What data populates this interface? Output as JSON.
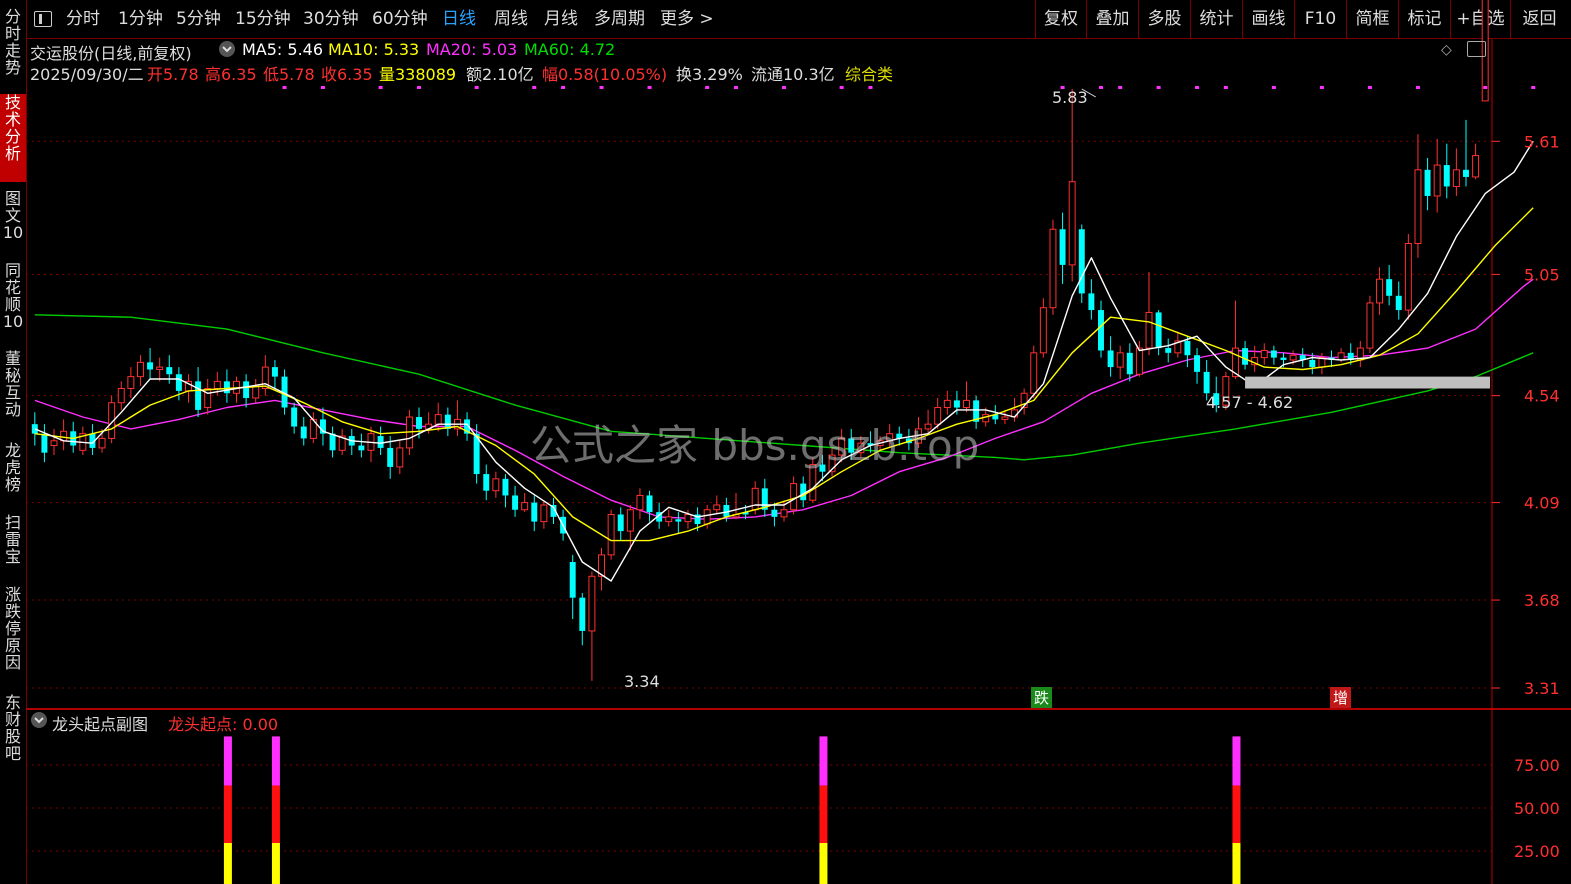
{
  "toolbar": {
    "tabs": [
      "分时",
      "1分钟",
      "5分钟",
      "15分钟",
      "30分钟",
      "60分钟",
      "日线",
      "周线",
      "月线",
      "多周期",
      "更多 >"
    ],
    "active_tab": "日线",
    "right_buttons": [
      "复权",
      "叠加",
      "多股",
      "统计",
      "画线",
      "F10",
      "简框",
      "标记",
      "+自选",
      "返回"
    ]
  },
  "sidebar": {
    "items": [
      "分时走势",
      "技术分析",
      "图文10",
      "同花顺10",
      "董秘互动",
      "龙虎榜",
      "扫雷宝",
      "涨跌停原因",
      "东财股吧"
    ],
    "active_item": "技术分析"
  },
  "stock": {
    "name_line": "交运股份(日线,前复权)",
    "ma5": "MA5: 5.46",
    "ma10": "MA10: 5.33",
    "ma20": "MA20: 5.03",
    "ma60": "MA60: 4.72",
    "date": "2025/09/30/二",
    "open": "开5.78",
    "high": "高6.35",
    "low": "低5.78",
    "close": "收6.35",
    "volume": "量338089",
    "amount": "额2.10亿",
    "change": "幅0.58(10.05%)",
    "turnover": "换3.29%",
    "float_cap": "流通10.3亿",
    "category": "综合类"
  },
  "main_chart": {
    "y_ticks": [
      "5.61",
      "5.05",
      "4.54",
      "4.09",
      "3.68",
      "3.31"
    ],
    "max_label": "5.83",
    "min_label": "3.34",
    "range_label": "4.57 - 4.62",
    "watermark": "公式之家 bbs.gszb.top",
    "tag_fall": "跌",
    "tag_inc": "增"
  },
  "sub_chart": {
    "title": "龙头起点副图",
    "indicator": "龙头起点: 0.00",
    "y_ticks": [
      "75.00",
      "50.00",
      "25.00"
    ]
  },
  "colors": {
    "up": "#ff3030",
    "down": "#00ffff",
    "ma5": "#ffffff",
    "ma10": "#ffff00",
    "ma20": "#ff30ff",
    "ma60": "#00cc00",
    "grid": "#7a0000"
  },
  "chart_data": {
    "type": "candlestick",
    "price_range": [
      3.31,
      5.83
    ],
    "candles": [
      [
        4.42,
        4.38,
        4.47,
        4.33
      ],
      [
        4.38,
        4.3,
        4.42,
        4.26
      ],
      [
        4.33,
        4.35,
        4.4,
        4.29
      ],
      [
        4.35,
        4.39,
        4.44,
        4.31
      ],
      [
        4.39,
        4.33,
        4.43,
        4.3
      ],
      [
        4.31,
        4.38,
        4.41,
        4.29
      ],
      [
        4.38,
        4.32,
        4.42,
        4.29
      ],
      [
        4.32,
        4.36,
        4.4,
        4.3
      ],
      [
        4.36,
        4.51,
        4.54,
        4.34
      ],
      [
        4.51,
        4.57,
        4.6,
        4.48
      ],
      [
        4.57,
        4.62,
        4.66,
        4.53
      ],
      [
        4.62,
        4.68,
        4.71,
        4.58
      ],
      [
        4.68,
        4.65,
        4.74,
        4.61
      ],
      [
        4.65,
        4.66,
        4.7,
        4.6
      ],
      [
        4.66,
        4.63,
        4.71,
        4.59
      ],
      [
        4.63,
        4.56,
        4.66,
        4.52
      ],
      [
        4.56,
        4.6,
        4.63,
        4.51
      ],
      [
        4.6,
        4.48,
        4.66,
        4.45
      ],
      [
        4.49,
        4.57,
        4.61,
        4.46
      ],
      [
        4.57,
        4.6,
        4.64,
        4.54
      ],
      [
        4.6,
        4.55,
        4.65,
        4.51
      ],
      [
        4.55,
        4.6,
        4.62,
        4.51
      ],
      [
        4.6,
        4.53,
        4.63,
        4.49
      ],
      [
        4.53,
        4.58,
        4.61,
        4.51
      ],
      [
        4.57,
        4.66,
        4.71,
        4.54
      ],
      [
        4.66,
        4.62,
        4.69,
        4.56
      ],
      [
        4.62,
        4.49,
        4.65,
        4.46
      ],
      [
        4.49,
        4.41,
        4.51,
        4.38
      ],
      [
        4.41,
        4.36,
        4.45,
        4.33
      ],
      [
        4.36,
        4.44,
        4.47,
        4.34
      ],
      [
        4.44,
        4.38,
        4.49,
        4.33
      ],
      [
        4.38,
        4.31,
        4.41,
        4.28
      ],
      [
        4.31,
        4.37,
        4.4,
        4.29
      ],
      [
        4.37,
        4.33,
        4.4,
        4.29
      ],
      [
        4.33,
        4.31,
        4.38,
        4.28
      ],
      [
        4.31,
        4.38,
        4.41,
        4.26
      ],
      [
        4.37,
        4.32,
        4.41,
        4.29
      ],
      [
        4.32,
        4.24,
        4.37,
        4.19
      ],
      [
        4.24,
        4.32,
        4.35,
        4.21
      ],
      [
        4.32,
        4.45,
        4.48,
        4.29
      ],
      [
        4.45,
        4.4,
        4.49,
        4.36
      ],
      [
        4.4,
        4.42,
        4.47,
        4.38
      ],
      [
        4.42,
        4.46,
        4.51,
        4.39
      ],
      [
        4.46,
        4.4,
        4.49,
        4.37
      ],
      [
        4.4,
        4.44,
        4.52,
        4.37
      ],
      [
        4.44,
        4.38,
        4.47,
        4.35
      ],
      [
        4.38,
        4.21,
        4.42,
        4.17
      ],
      [
        4.21,
        4.14,
        4.25,
        4.1
      ],
      [
        4.14,
        4.19,
        4.22,
        4.11
      ],
      [
        4.19,
        4.12,
        4.21,
        4.07
      ],
      [
        4.12,
        4.06,
        4.16,
        4.03
      ],
      [
        4.06,
        4.09,
        4.13,
        4.05
      ],
      [
        4.09,
        4.01,
        4.12,
        3.97
      ],
      [
        4.01,
        4.08,
        4.1,
        3.98
      ],
      [
        4.08,
        4.03,
        4.11,
        4.0
      ],
      [
        4.03,
        3.96,
        4.06,
        3.93
      ],
      [
        3.84,
        3.69,
        3.87,
        3.6
      ],
      [
        3.69,
        3.55,
        3.71,
        3.49
      ],
      [
        3.55,
        3.78,
        3.8,
        3.34
      ],
      [
        3.78,
        3.87,
        3.9,
        3.72
      ],
      [
        3.87,
        4.04,
        4.06,
        3.85
      ],
      [
        4.04,
        3.97,
        4.07,
        3.93
      ],
      [
        3.97,
        4.06,
        4.08,
        3.89
      ],
      [
        4.06,
        4.12,
        4.15,
        4.02
      ],
      [
        4.12,
        4.05,
        4.14,
        4.01
      ],
      [
        4.05,
        4.01,
        4.09,
        3.98
      ],
      [
        4.01,
        4.03,
        4.06,
        3.99
      ],
      [
        4.02,
        4.01,
        4.05,
        3.96
      ],
      [
        4.01,
        4.04,
        4.06,
        3.98
      ],
      [
        4.04,
        4.0,
        4.07,
        3.97
      ],
      [
        4.0,
        4.06,
        4.08,
        3.98
      ],
      [
        4.06,
        4.08,
        4.12,
        4.04
      ],
      [
        4.08,
        4.03,
        4.11,
        4.01
      ],
      [
        4.03,
        4.04,
        4.13,
        4.02
      ],
      [
        4.05,
        4.04,
        4.08,
        4.02
      ],
      [
        4.06,
        4.15,
        4.18,
        4.04
      ],
      [
        4.15,
        4.06,
        4.19,
        4.03
      ],
      [
        4.06,
        4.03,
        4.09,
        3.99
      ],
      [
        4.03,
        4.06,
        4.1,
        4.01
      ],
      [
        4.06,
        4.17,
        4.2,
        4.04
      ],
      [
        4.17,
        4.1,
        4.2,
        4.07
      ],
      [
        4.1,
        4.25,
        4.28,
        4.09
      ],
      [
        4.25,
        4.22,
        4.29,
        4.18
      ],
      [
        4.22,
        4.29,
        4.32,
        4.2
      ],
      [
        4.29,
        4.36,
        4.4,
        4.26
      ],
      [
        4.36,
        4.3,
        4.4,
        4.27
      ],
      [
        4.3,
        4.34,
        4.37,
        4.28
      ],
      [
        4.34,
        4.33,
        4.39,
        4.3
      ],
      [
        4.33,
        4.35,
        4.37,
        4.31
      ],
      [
        4.35,
        4.38,
        4.42,
        4.32
      ],
      [
        4.38,
        4.36,
        4.41,
        4.33
      ],
      [
        4.36,
        4.34,
        4.4,
        4.31
      ],
      [
        4.34,
        4.4,
        4.45,
        4.32
      ],
      [
        4.4,
        4.42,
        4.48,
        4.38
      ],
      [
        4.42,
        4.49,
        4.53,
        4.4
      ],
      [
        4.49,
        4.52,
        4.56,
        4.46
      ],
      [
        4.52,
        4.49,
        4.56,
        4.46
      ],
      [
        4.49,
        4.52,
        4.6,
        4.47
      ],
      [
        4.52,
        4.43,
        4.54,
        4.4
      ],
      [
        4.43,
        4.46,
        4.49,
        4.41
      ],
      [
        4.46,
        4.44,
        4.5,
        4.42
      ],
      [
        4.44,
        4.45,
        4.48,
        4.42
      ],
      [
        4.45,
        4.48,
        4.53,
        4.43
      ],
      [
        4.49,
        4.55,
        4.57,
        4.46
      ],
      [
        4.55,
        4.72,
        4.75,
        4.53
      ],
      [
        4.72,
        4.91,
        4.95,
        4.7
      ],
      [
        4.91,
        5.24,
        5.28,
        4.88
      ],
      [
        5.24,
        5.09,
        5.31,
        5.01
      ],
      [
        5.09,
        5.44,
        5.83,
        5.02
      ],
      [
        5.24,
        4.97,
        5.26,
        4.93
      ],
      [
        4.97,
        4.9,
        5.03,
        4.86
      ],
      [
        4.9,
        4.73,
        4.94,
        4.7
      ],
      [
        4.73,
        4.66,
        4.79,
        4.62
      ],
      [
        4.66,
        4.72,
        4.75,
        4.61
      ],
      [
        4.72,
        4.63,
        4.76,
        4.6
      ],
      [
        4.63,
        4.74,
        4.77,
        4.62
      ],
      [
        4.74,
        4.89,
        5.06,
        4.71
      ],
      [
        4.89,
        4.74,
        4.9,
        4.71
      ],
      [
        4.74,
        4.72,
        4.78,
        4.68
      ],
      [
        4.72,
        4.77,
        4.81,
        4.7
      ],
      [
        4.77,
        4.71,
        4.79,
        4.66
      ],
      [
        4.71,
        4.64,
        4.74,
        4.59
      ],
      [
        4.64,
        4.55,
        4.69,
        4.52
      ],
      [
        4.55,
        4.5,
        4.62,
        4.47
      ],
      [
        4.5,
        4.62,
        4.64,
        4.48
      ],
      [
        4.62,
        4.74,
        4.94,
        4.61
      ],
      [
        4.74,
        4.67,
        4.77,
        4.65
      ],
      [
        4.67,
        4.7,
        4.75,
        4.64
      ],
      [
        4.7,
        4.73,
        4.76,
        4.67
      ],
      [
        4.73,
        4.7,
        4.75,
        4.67
      ],
      [
        4.7,
        4.69,
        4.72,
        4.66
      ],
      [
        4.69,
        4.71,
        4.73,
        4.67
      ],
      [
        4.71,
        4.69,
        4.74,
        4.66
      ],
      [
        4.69,
        4.66,
        4.72,
        4.63
      ],
      [
        4.66,
        4.7,
        4.72,
        4.63
      ],
      [
        4.7,
        4.69,
        4.73,
        4.66
      ],
      [
        4.69,
        4.72,
        4.74,
        4.68
      ],
      [
        4.72,
        4.69,
        4.76,
        4.67
      ],
      [
        4.69,
        4.74,
        4.77,
        4.66
      ],
      [
        4.74,
        4.93,
        4.96,
        4.72
      ],
      [
        4.93,
        5.03,
        5.08,
        4.88
      ],
      [
        5.03,
        4.96,
        5.09,
        4.92
      ],
      [
        4.96,
        4.9,
        5.02,
        4.86
      ],
      [
        4.9,
        5.18,
        5.22,
        4.86
      ],
      [
        5.18,
        5.49,
        5.64,
        5.12
      ],
      [
        5.49,
        5.38,
        5.54,
        5.32
      ],
      [
        5.38,
        5.51,
        5.62,
        5.31
      ],
      [
        5.51,
        5.42,
        5.6,
        5.37
      ],
      [
        5.42,
        5.49,
        5.58,
        5.38
      ],
      [
        5.49,
        5.46,
        5.7,
        5.42
      ],
      [
        5.46,
        5.55,
        5.6,
        5.45
      ],
      [
        5.78,
        6.35,
        6.35,
        5.78
      ]
    ],
    "ma5": [
      [
        0,
        4.4
      ],
      [
        3,
        4.35
      ],
      [
        6,
        4.34
      ],
      [
        9,
        4.47
      ],
      [
        12,
        4.61
      ],
      [
        15,
        4.61
      ],
      [
        18,
        4.55
      ],
      [
        21,
        4.57
      ],
      [
        24,
        4.59
      ],
      [
        27,
        4.53
      ],
      [
        30,
        4.39
      ],
      [
        33,
        4.35
      ],
      [
        36,
        4.34
      ],
      [
        39,
        4.36
      ],
      [
        42,
        4.42
      ],
      [
        45,
        4.42
      ],
      [
        48,
        4.26
      ],
      [
        51,
        4.15
      ],
      [
        54,
        4.07
      ],
      [
        57,
        3.84
      ],
      [
        60,
        3.76
      ],
      [
        63,
        3.97
      ],
      [
        66,
        4.07
      ],
      [
        69,
        4.03
      ],
      [
        72,
        4.05
      ],
      [
        75,
        4.08
      ],
      [
        78,
        4.08
      ],
      [
        81,
        4.15
      ],
      [
        84,
        4.27
      ],
      [
        87,
        4.33
      ],
      [
        90,
        4.36
      ],
      [
        93,
        4.38
      ],
      [
        96,
        4.48
      ],
      [
        99,
        4.48
      ],
      [
        102,
        4.45
      ],
      [
        105,
        4.59
      ],
      [
        108,
        4.96
      ],
      [
        110,
        5.12
      ],
      [
        112,
        4.95
      ],
      [
        115,
        4.73
      ],
      [
        118,
        4.75
      ],
      [
        121,
        4.79
      ],
      [
        124,
        4.66
      ],
      [
        127,
        4.58
      ],
      [
        130,
        4.67
      ],
      [
        133,
        4.7
      ],
      [
        136,
        4.69
      ],
      [
        139,
        4.7
      ],
      [
        142,
        4.82
      ],
      [
        145,
        4.97
      ],
      [
        148,
        5.21
      ],
      [
        151,
        5.39
      ],
      [
        154,
        5.48
      ],
      [
        156,
        5.61
      ]
    ],
    "ma10": [
      [
        0,
        4.38
      ],
      [
        4,
        4.36
      ],
      [
        8,
        4.4
      ],
      [
        12,
        4.5
      ],
      [
        16,
        4.56
      ],
      [
        20,
        4.57
      ],
      [
        24,
        4.58
      ],
      [
        28,
        4.51
      ],
      [
        32,
        4.43
      ],
      [
        36,
        4.38
      ],
      [
        40,
        4.39
      ],
      [
        44,
        4.41
      ],
      [
        48,
        4.33
      ],
      [
        52,
        4.21
      ],
      [
        56,
        4.03
      ],
      [
        60,
        3.93
      ],
      [
        64,
        3.93
      ],
      [
        68,
        3.97
      ],
      [
        72,
        4.03
      ],
      [
        76,
        4.07
      ],
      [
        80,
        4.12
      ],
      [
        84,
        4.22
      ],
      [
        88,
        4.31
      ],
      [
        92,
        4.36
      ],
      [
        96,
        4.42
      ],
      [
        100,
        4.46
      ],
      [
        104,
        4.52
      ],
      [
        108,
        4.72
      ],
      [
        112,
        4.87
      ],
      [
        116,
        4.85
      ],
      [
        120,
        4.79
      ],
      [
        124,
        4.73
      ],
      [
        128,
        4.66
      ],
      [
        132,
        4.65
      ],
      [
        136,
        4.67
      ],
      [
        140,
        4.71
      ],
      [
        144,
        4.8
      ],
      [
        148,
        4.98
      ],
      [
        152,
        5.17
      ],
      [
        156,
        5.33
      ]
    ],
    "ma20": [
      [
        0,
        4.52
      ],
      [
        5,
        4.45
      ],
      [
        10,
        4.4
      ],
      [
        15,
        4.44
      ],
      [
        20,
        4.49
      ],
      [
        25,
        4.52
      ],
      [
        30,
        4.48
      ],
      [
        35,
        4.44
      ],
      [
        40,
        4.41
      ],
      [
        45,
        4.41
      ],
      [
        50,
        4.31
      ],
      [
        55,
        4.2
      ],
      [
        60,
        4.1
      ],
      [
        65,
        4.03
      ],
      [
        70,
        4.02
      ],
      [
        75,
        4.03
      ],
      [
        80,
        4.06
      ],
      [
        85,
        4.12
      ],
      [
        90,
        4.22
      ],
      [
        95,
        4.28
      ],
      [
        100,
        4.36
      ],
      [
        105,
        4.43
      ],
      [
        110,
        4.55
      ],
      [
        115,
        4.63
      ],
      [
        120,
        4.69
      ],
      [
        125,
        4.73
      ],
      [
        130,
        4.72
      ],
      [
        135,
        4.7
      ],
      [
        140,
        4.71
      ],
      [
        145,
        4.74
      ],
      [
        150,
        4.82
      ],
      [
        155,
        5.0
      ],
      [
        156,
        5.03
      ]
    ],
    "ma60": [
      [
        0,
        4.88
      ],
      [
        10,
        4.87
      ],
      [
        20,
        4.82
      ],
      [
        30,
        4.72
      ],
      [
        40,
        4.63
      ],
      [
        50,
        4.5
      ],
      [
        60,
        4.39
      ],
      [
        70,
        4.36
      ],
      [
        80,
        4.33
      ],
      [
        90,
        4.3
      ],
      [
        100,
        4.28
      ],
      [
        103,
        4.27
      ],
      [
        108,
        4.29
      ],
      [
        115,
        4.34
      ],
      [
        125,
        4.4
      ],
      [
        135,
        4.47
      ],
      [
        145,
        4.56
      ],
      [
        150,
        4.62
      ],
      [
        156,
        4.72
      ]
    ],
    "sub_signals": [
      {
        "index": 20,
        "value": 90
      },
      {
        "index": 25,
        "value": 90
      },
      {
        "index": 82,
        "value": 90
      },
      {
        "index": 125,
        "value": 90
      }
    ],
    "sub_range": [
      0,
      100
    ]
  }
}
